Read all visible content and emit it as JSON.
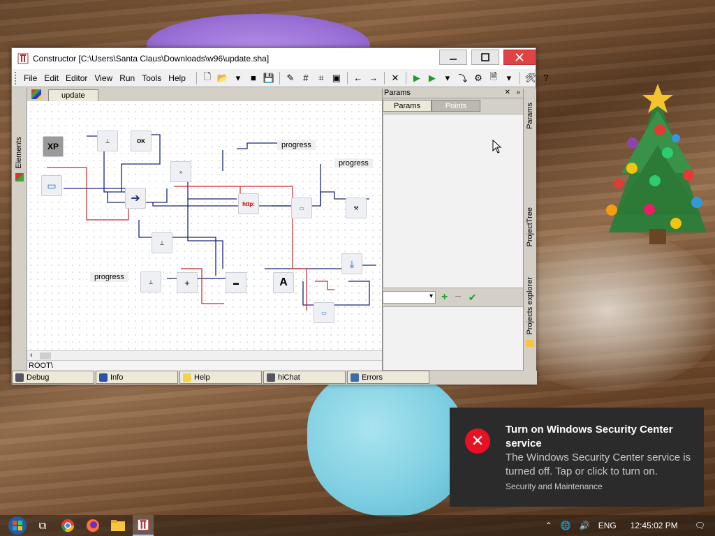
{
  "window": {
    "title": "Constructor [C:\\Users\\Santa Claus\\Downloads\\w96\\update.sha]",
    "menu": [
      "File",
      "Edit",
      "Editor",
      "View",
      "Run",
      "Tools",
      "Help"
    ]
  },
  "left_panel": {
    "elements_tab": "Elements"
  },
  "document_tab": {
    "label": "update"
  },
  "canvas": {
    "labels": [
      "progress",
      "progress",
      "progress"
    ],
    "xp_label": "XP",
    "ok_label": "OK",
    "http_label": "http:",
    "plus_label": "+",
    "a_label": "A"
  },
  "path_bar": {
    "path": "ROOT\\"
  },
  "bottom_tabs": [
    "Debug",
    "Info",
    "Help",
    "hiChat",
    "Errors"
  ],
  "params_panel": {
    "header": "Params",
    "tabs": [
      "Params",
      "Points"
    ],
    "add": "+",
    "remove": "−",
    "apply": "✔"
  },
  "right_strip": {
    "tabs": [
      "Params",
      "ProjectTree",
      "Projects explorer"
    ]
  },
  "notification": {
    "title": "Turn on Windows Security Center service",
    "body": "The Windows Security Center service is turned off. Tap or click to turn on.",
    "source": "Security and Maintenance"
  },
  "taskbar": {
    "language": "ENG",
    "time": "12:45:02 PM"
  },
  "colors": {
    "close_button": "#e04343",
    "toast_bg": "#2b2b2b",
    "error_red": "#e81123"
  }
}
